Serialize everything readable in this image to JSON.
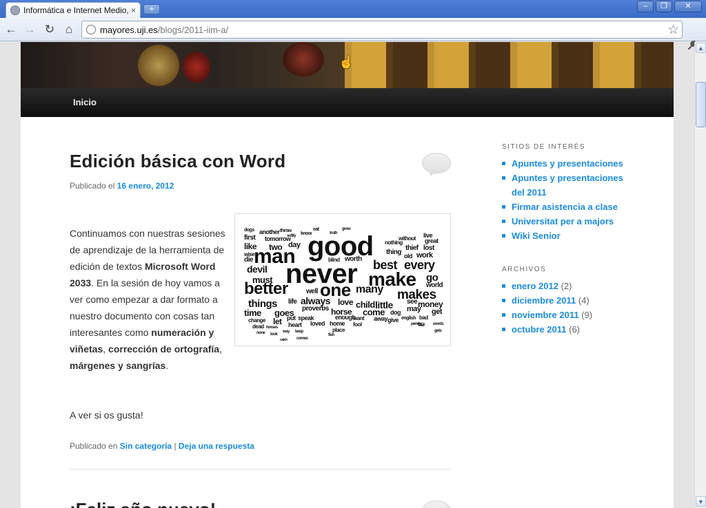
{
  "browser": {
    "tab_title": "Informática e Internet Medio,",
    "tab_close": "×",
    "new_tab": "+",
    "url_host": "mayores.uji.es",
    "url_path": "/blogs/2011-iim-a/",
    "win_minimize": "‒",
    "win_restore": "❐",
    "win_close": "✕"
  },
  "nav": {
    "back": "←",
    "forward": "→",
    "reload": "↻",
    "home": "⌂",
    "star": "☆",
    "wrench": "🔧"
  },
  "site": {
    "menu_item": "Inicio"
  },
  "post": {
    "title": "Edición básica con Word",
    "meta_prefix": "Publicado el",
    "date": "16 enero, 2012",
    "body_1": "Continuamos con nuestras sesiones de aprendizaje de la herramienta de edición de textos ",
    "body_bold_1": "Microsoft Word 2033",
    "body_2": ". En la sesión de hoy vamos a ver como empezar a dar formato a nuestro documento con cosas tan interesantes como ",
    "body_bold_2": "numeración y viñetas",
    "body_3": ", ",
    "body_bold_3": "corrección de ortografía",
    "body_4": ", ",
    "body_bold_4": "márgenes y sangrías",
    "body_5": ".",
    "greeting": "A ver si os gusta!",
    "footer_prefix": "Publicado en",
    "category": "Sin categoría",
    "separator": "|",
    "reply": "Deja una respuesta"
  },
  "next_post": {
    "title": "¡Feliz año nuevo!"
  },
  "wordcloud": {
    "words": [
      {
        "t": "good",
        "s": 40
      },
      {
        "t": "never",
        "s": 40
      },
      {
        "t": "man",
        "s": 30
      },
      {
        "t": "make",
        "s": 28
      },
      {
        "t": "better",
        "s": 24
      },
      {
        "t": "one",
        "s": 26
      },
      {
        "t": "makes",
        "s": 19
      },
      {
        "t": "every",
        "s": 18
      },
      {
        "t": "best",
        "s": 18
      },
      {
        "t": "many",
        "s": 16
      },
      {
        "t": "things",
        "s": 15
      },
      {
        "t": "always",
        "s": 14
      },
      {
        "t": "devil",
        "s": 14
      },
      {
        "t": "little",
        "s": 14
      },
      {
        "t": "must",
        "s": 13
      },
      {
        "t": "time",
        "s": 13
      },
      {
        "t": "goes",
        "s": 13
      },
      {
        "t": "come",
        "s": 13
      },
      {
        "t": "child",
        "s": 13
      },
      {
        "t": "horse",
        "s": 12
      },
      {
        "t": "money",
        "s": 12
      },
      {
        "t": "go",
        "s": 15
      },
      {
        "t": "love",
        "s": 12
      },
      {
        "t": "two",
        "s": 12
      },
      {
        "t": "like",
        "s": 12
      },
      {
        "t": "day",
        "s": 11
      },
      {
        "t": "work",
        "s": 11
      },
      {
        "t": "thief",
        "s": 10
      },
      {
        "t": "lost",
        "s": 10
      },
      {
        "t": "get",
        "s": 11
      },
      {
        "t": "may",
        "s": 11
      },
      {
        "t": "world",
        "s": 10
      },
      {
        "t": "worth",
        "s": 10
      },
      {
        "t": "let",
        "s": 12
      },
      {
        "t": "life",
        "s": 10
      },
      {
        "t": "well",
        "s": 10
      },
      {
        "t": "proverbs",
        "s": 10
      },
      {
        "t": "die",
        "s": 10
      },
      {
        "t": "first",
        "s": 10
      },
      {
        "t": "another",
        "s": 9
      },
      {
        "t": "tomorrow",
        "s": 9
      },
      {
        "t": "speak",
        "s": 9
      },
      {
        "t": "heart",
        "s": 9
      },
      {
        "t": "loved",
        "s": 9
      },
      {
        "t": "home",
        "s": 9
      },
      {
        "t": "enough",
        "s": 9
      },
      {
        "t": "dog",
        "s": 9
      },
      {
        "t": "give",
        "s": 9
      },
      {
        "t": "bad",
        "s": 8
      },
      {
        "t": "fair",
        "s": 8
      },
      {
        "t": "great",
        "s": 9
      },
      {
        "t": "live",
        "s": 9
      },
      {
        "t": "without",
        "s": 8
      },
      {
        "t": "nothing",
        "s": 8
      },
      {
        "t": "thing",
        "s": 10
      },
      {
        "t": "old",
        "s": 9
      },
      {
        "t": "see",
        "s": 10
      },
      {
        "t": "dead",
        "s": 8
      },
      {
        "t": "change",
        "s": 8
      },
      {
        "t": "put",
        "s": 9
      },
      {
        "t": "blind",
        "s": 8
      },
      {
        "t": "wise",
        "s": 8
      },
      {
        "t": "dogs",
        "s": 7
      },
      {
        "t": "throw",
        "s": 7
      },
      {
        "t": "eat",
        "s": 7
      },
      {
        "t": "grow",
        "s": 6
      },
      {
        "t": "know",
        "s": 7
      },
      {
        "t": "softly",
        "s": 6
      },
      {
        "t": "truth",
        "s": 6
      },
      {
        "t": "place",
        "s": 8
      },
      {
        "t": "fool",
        "s": 8
      },
      {
        "t": "away",
        "s": 9
      },
      {
        "t": "want",
        "s": 8
      },
      {
        "t": "english",
        "s": 7
      },
      {
        "t": "penny",
        "s": 6
      },
      {
        "t": "words",
        "s": 6
      },
      {
        "t": "gets",
        "s": 6
      },
      {
        "t": "horses",
        "s": 6
      },
      {
        "t": "way",
        "s": 6
      },
      {
        "t": "keep",
        "s": 6
      },
      {
        "t": "fish",
        "s": 6
      },
      {
        "t": "comes",
        "s": 6
      },
      {
        "t": "none",
        "s": 6
      },
      {
        "t": "look",
        "s": 6
      },
      {
        "t": "catch",
        "s": 5
      }
    ]
  },
  "sidebar": {
    "sites_title": "SITIOS DE INTERÉS",
    "sites": [
      "Apuntes y presentaciones",
      "Apuntes y presentaciones del 2011",
      "Firmar asistencia a clase",
      "Universitat per a majors",
      "Wiki Senior"
    ],
    "archives_title": "ARCHIVOS",
    "archives": [
      {
        "label": "enero 2012",
        "count": "(2)"
      },
      {
        "label": "diciembre 2011",
        "count": "(4)"
      },
      {
        "label": "noviembre 2011",
        "count": "(9)"
      },
      {
        "label": "octubre 2011",
        "count": "(6)"
      }
    ]
  },
  "colors": {
    "link": "#1b8be0",
    "title_bar": "#3a6cc7",
    "nav_bg": "#111111"
  }
}
